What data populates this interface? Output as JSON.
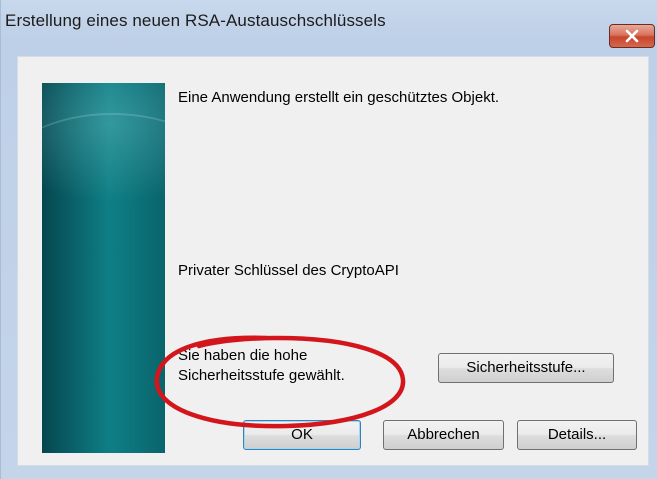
{
  "window": {
    "title": "Erstellung eines neuen RSA-Austauschschlüssels",
    "close_label": "Schließen"
  },
  "dialog": {
    "message": "Eine Anwendung erstellt ein geschütztes Objekt.",
    "object_name": "Privater Schlüssel des CryptoAPI",
    "security_line1": "Sie haben die hohe",
    "security_line2": "Sicherheitsstufe gewählt."
  },
  "buttons": {
    "security_level": "Sicherheitsstufe...",
    "ok": "OK",
    "cancel": "Abbrechen",
    "details": "Details..."
  },
  "annotation": {
    "color": "#d2161c",
    "shape": "ellipse"
  },
  "icons": {
    "close": "close-icon"
  }
}
